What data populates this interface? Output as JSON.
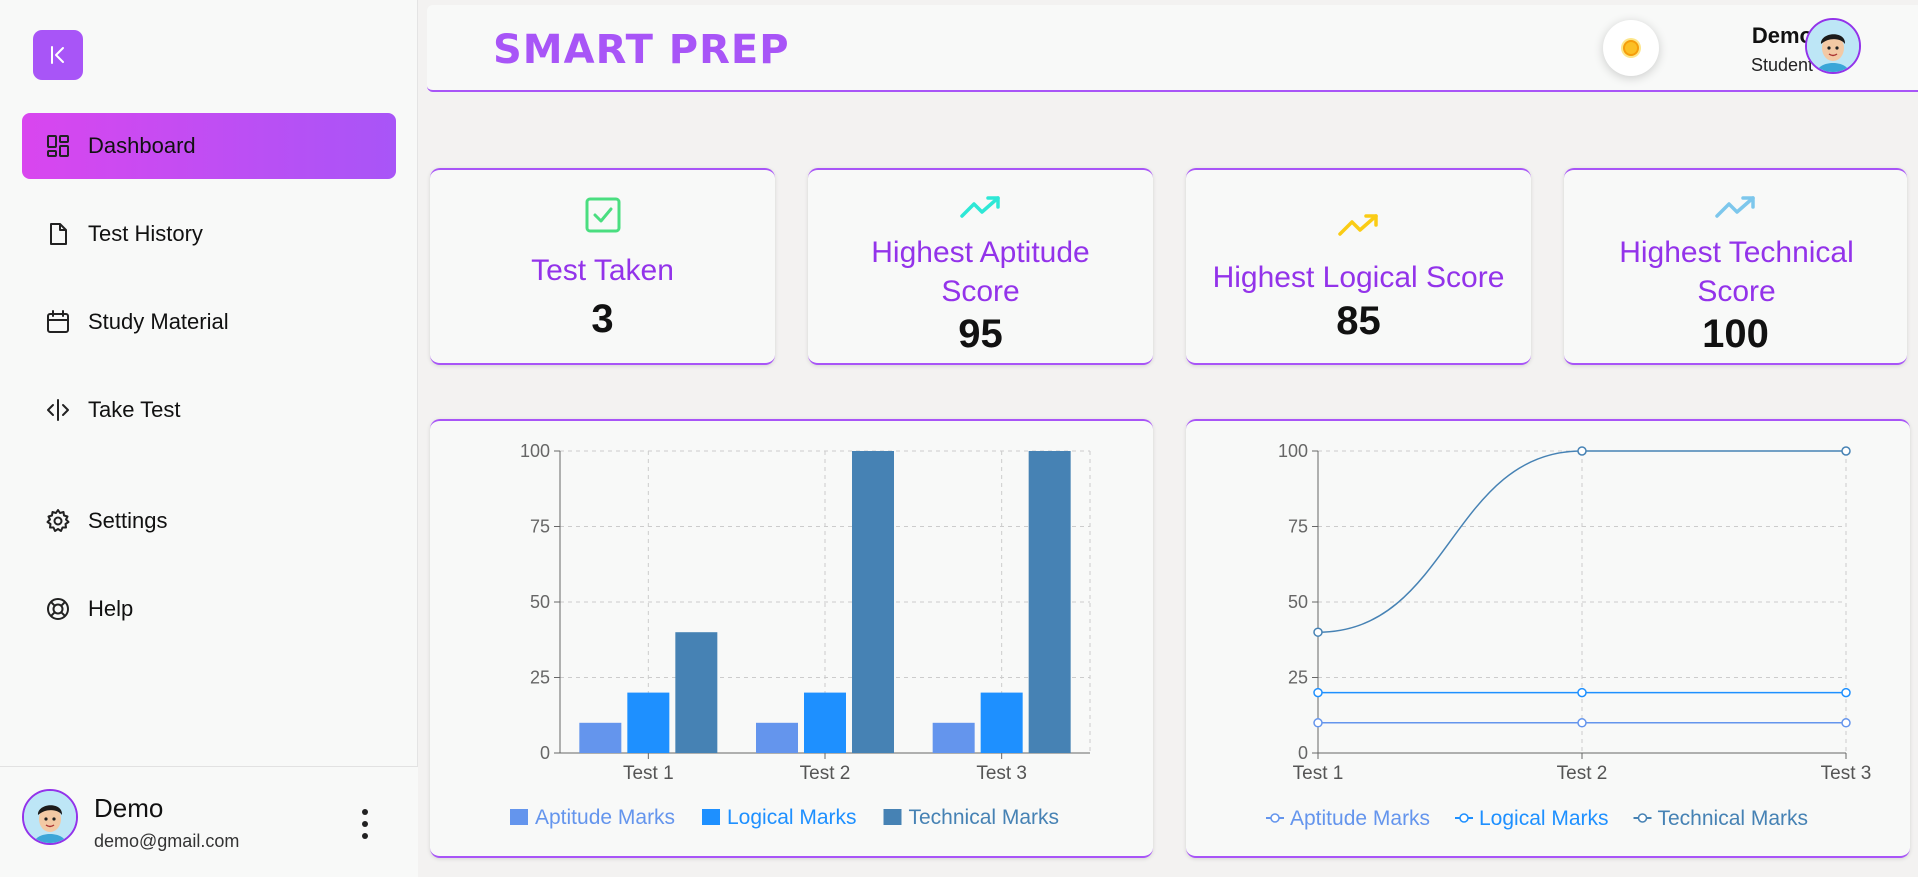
{
  "sidebar": {
    "items": [
      {
        "label": "Dashboard",
        "icon": "dashboard-icon"
      },
      {
        "label": "Test History",
        "icon": "file-icon"
      },
      {
        "label": "Study Material",
        "icon": "calendar-icon"
      },
      {
        "label": "Take Test",
        "icon": "code-icon"
      },
      {
        "label": "Settings",
        "icon": "gear-icon"
      },
      {
        "label": "Help",
        "icon": "lifebuoy-icon"
      }
    ],
    "profile": {
      "name": "Demo",
      "email": "demo@gmail.com"
    }
  },
  "header": {
    "brand": "SMART PREP",
    "user_name": "Demo",
    "user_role": "Student"
  },
  "stats": [
    {
      "label": "Test Taken",
      "value": "3",
      "icon": "checkbox-icon",
      "color": "#4ade80"
    },
    {
      "label": "Highest Aptitude Score",
      "value": "95",
      "icon": "trending-up-icon",
      "color": "#2ee8d6"
    },
    {
      "label": "Highest Logical Score",
      "value": "85",
      "icon": "trending-up-icon",
      "color": "#facc15"
    },
    {
      "label": "Highest Technical Score",
      "value": "100",
      "icon": "trending-up-icon",
      "color": "#7dc7ec"
    }
  ],
  "colors": {
    "accent": "#a855f7",
    "aptitude": "#6495ed",
    "logical": "#1e90ff",
    "technical": "#4682b4"
  },
  "chart_data": [
    {
      "type": "bar",
      "categories": [
        "Test 1",
        "Test 2",
        "Test 3"
      ],
      "series": [
        {
          "name": "Aptitude Marks",
          "values": [
            10,
            10,
            10
          ]
        },
        {
          "name": "Logical Marks",
          "values": [
            20,
            20,
            20
          ]
        },
        {
          "name": "Technical Marks",
          "values": [
            40,
            100,
            100
          ]
        }
      ],
      "yticks": [
        0,
        25,
        50,
        75,
        100
      ],
      "ylim": [
        0,
        100
      ],
      "grid": true,
      "legend": "bottom"
    },
    {
      "type": "line",
      "categories": [
        "Test 1",
        "Test 2",
        "Test 3"
      ],
      "series": [
        {
          "name": "Aptitude Marks",
          "values": [
            10,
            10,
            10
          ]
        },
        {
          "name": "Logical Marks",
          "values": [
            20,
            20,
            20
          ]
        },
        {
          "name": "Technical Marks",
          "values": [
            40,
            100,
            100
          ]
        }
      ],
      "yticks": [
        0,
        25,
        50,
        75,
        100
      ],
      "ylim": [
        0,
        100
      ],
      "grid": true,
      "legend": "bottom"
    }
  ]
}
